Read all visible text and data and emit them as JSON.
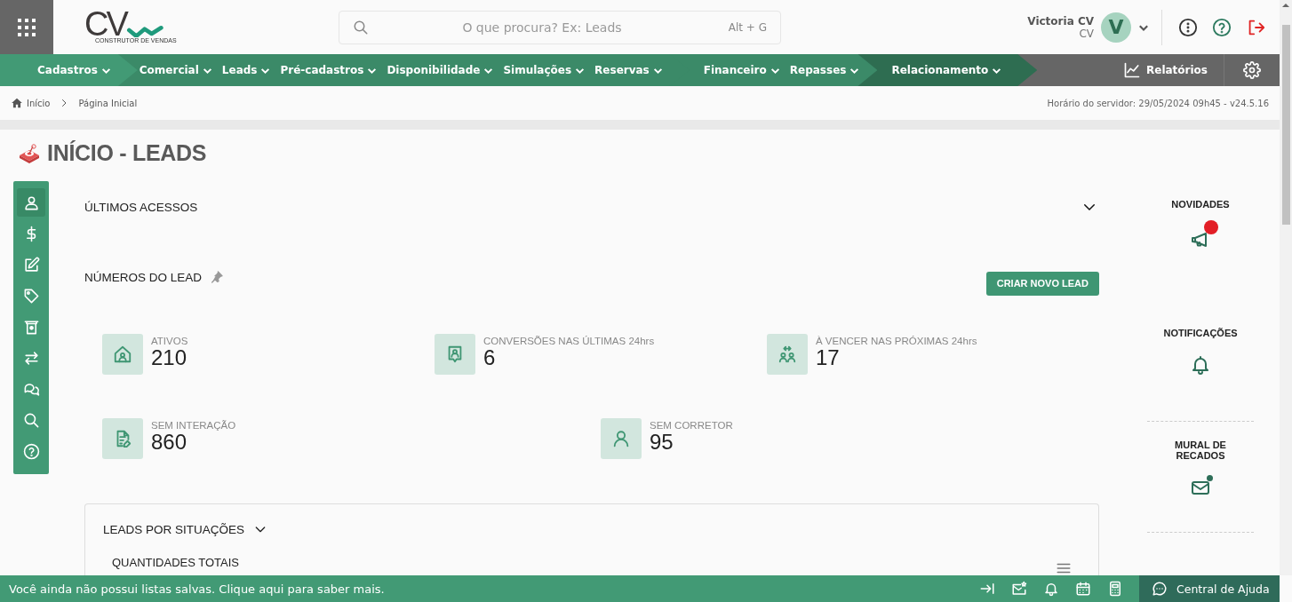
{
  "header": {
    "logo": {
      "letters": "CV",
      "caption": "CONSTRUTOR DE VENDAS"
    },
    "search": {
      "placeholder": "O que procura? Ex: Leads",
      "shortcut": "Alt + G"
    },
    "user": {
      "name": "Victoria CV",
      "company": "CV",
      "avatar_letter": "V"
    }
  },
  "nav": {
    "groups": [
      {
        "kind": "light",
        "items": [
          "Cadastros"
        ]
      },
      {
        "kind": "mid",
        "items": [
          "Comercial",
          "Leads",
          "Pré-cadastros",
          "Disponibilidade",
          "Simulações",
          "Reservas"
        ]
      },
      {
        "kind": "mid",
        "items": [
          "Financeiro",
          "Repasses"
        ]
      },
      {
        "kind": "dark",
        "items": [
          "Relacionamento"
        ]
      }
    ],
    "reports": "Relatórios"
  },
  "breadcrumb": {
    "items": [
      "Início",
      "Página Inicial"
    ],
    "server_time": "Horário do servidor: 29/05/2024 09h45 - v24.5.16"
  },
  "page_title": "INÍCIO - LEADS",
  "sidebar": {
    "items": [
      {
        "selected": true
      },
      {
        "selected": false
      },
      {
        "selected": false
      },
      {
        "selected": false
      },
      {
        "selected": false
      },
      {
        "selected": false
      },
      {
        "selected": false
      },
      {
        "selected": false
      },
      {
        "selected": false
      }
    ]
  },
  "recent": {
    "title": "ÚLTIMOS ACESSOS",
    "expanded": false
  },
  "lead_numbers": {
    "title": "NÚMEROS DO LEAD",
    "create_button": "CRIAR NOVO LEAD",
    "rows": [
      [
        {
          "label": "ATIVOS",
          "value": "210"
        },
        {
          "label": "CONVERSÕES NAS ÚLTIMAS 24hrs",
          "value": "6"
        },
        {
          "label": "À VENCER NAS PRÓXIMAS 24hrs",
          "value": "17"
        }
      ],
      [
        {
          "label": "SEM INTERAÇÃO",
          "value": "860"
        },
        {
          "label": "SEM CORRETOR",
          "value": "95"
        }
      ]
    ]
  },
  "situations": {
    "title": "LEADS POR SITUAÇÕES",
    "subtitle": "QUANTIDADES TOTAIS"
  },
  "right_panel": [
    {
      "title": "NOVIDADES",
      "unread": true
    },
    {
      "title": "NOTIFICAÇÕES",
      "unread": false
    },
    {
      "title": "MURAL DE RECADOS",
      "unread": true
    }
  ],
  "footer": {
    "message": "Você ainda não possui listas salvas. Clique aqui para saber mais.",
    "help": "Central de Ajuda"
  }
}
